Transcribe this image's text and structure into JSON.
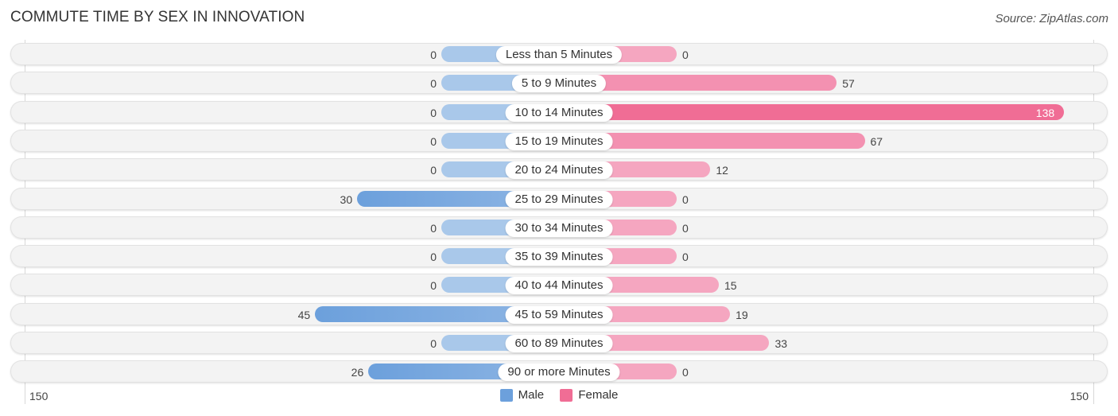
{
  "chart_data": {
    "type": "bar",
    "orientation": "horizontal-diverging",
    "title": "COMMUTE TIME BY SEX IN INNOVATION",
    "source": "Source: ZipAtlas.com",
    "categories": [
      "Less than 5 Minutes",
      "5 to 9 Minutes",
      "10 to 14 Minutes",
      "15 to 19 Minutes",
      "20 to 24 Minutes",
      "25 to 29 Minutes",
      "30 to 34 Minutes",
      "35 to 39 Minutes",
      "40 to 44 Minutes",
      "45 to 59 Minutes",
      "60 to 89 Minutes",
      "90 or more Minutes"
    ],
    "series": [
      {
        "name": "Male",
        "color": "#6ca0dc",
        "light_color": "#a9c8ea",
        "values": [
          0,
          0,
          0,
          0,
          0,
          30,
          0,
          0,
          0,
          45,
          0,
          26
        ]
      },
      {
        "name": "Female",
        "color": "#f06d95",
        "light_color": "#f5a6c0",
        "values": [
          0,
          57,
          138,
          67,
          12,
          0,
          0,
          0,
          15,
          19,
          33,
          0
        ]
      }
    ],
    "xlim": [
      -150,
      150
    ],
    "axis_labels": {
      "left": "150",
      "right": "150"
    },
    "legend": {
      "position": "bottom-center",
      "items": [
        "Male",
        "Female"
      ]
    }
  }
}
